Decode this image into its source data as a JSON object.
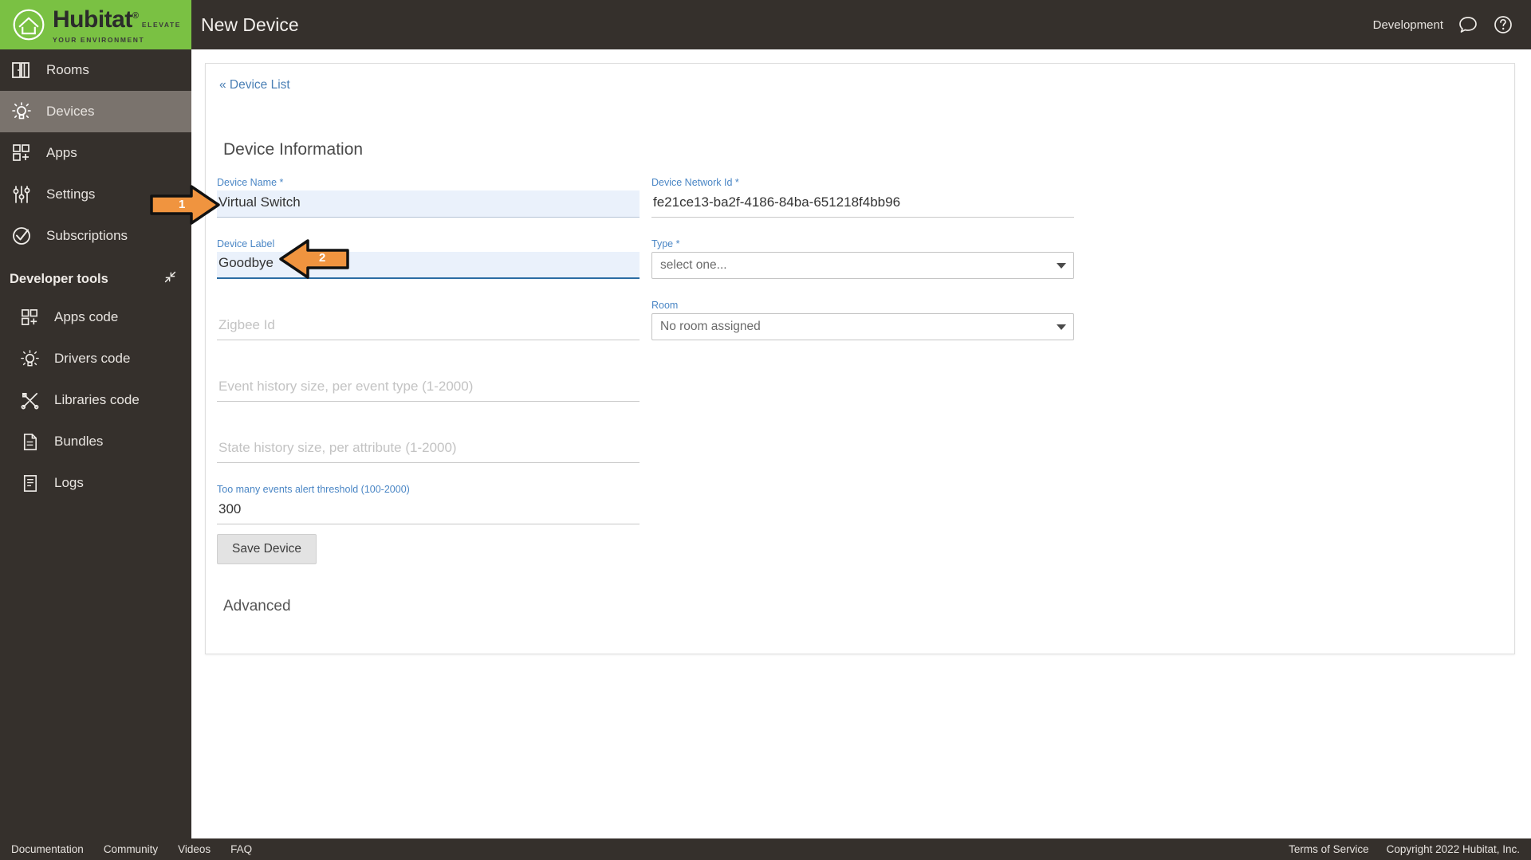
{
  "brand": {
    "name": "Hubitat",
    "registered": "®",
    "tagline": "ELEVATE YOUR ENVIRONMENT",
    "green": "#7ac143",
    "sidebar_bg": "#35302c"
  },
  "sidebar": {
    "items": [
      {
        "label": "Rooms",
        "icon": "door-icon",
        "active": false
      },
      {
        "label": "Devices",
        "icon": "bulb-icon",
        "active": true
      },
      {
        "label": "Apps",
        "icon": "grid-plus-icon",
        "active": false
      },
      {
        "label": "Settings",
        "icon": "sliders-icon",
        "active": false
      },
      {
        "label": "Subscriptions",
        "icon": "check-circle-icon",
        "active": false
      }
    ],
    "dev_tools": {
      "label": "Developer tools",
      "collapse_icon": "collapse-arrows-icon",
      "items": [
        {
          "label": "Apps code",
          "icon": "grid-plus-icon"
        },
        {
          "label": "Drivers code",
          "icon": "bulb-icon"
        },
        {
          "label": "Libraries code",
          "icon": "tools-icon"
        },
        {
          "label": "Bundles",
          "icon": "document-icon"
        },
        {
          "label": "Logs",
          "icon": "log-icon"
        }
      ]
    }
  },
  "topbar": {
    "title": "New Device",
    "environment": "Development",
    "chat_icon": "chat-bubble-icon",
    "help_icon": "help-circle-icon"
  },
  "main": {
    "back_link": "« Device List",
    "section_title": "Device Information",
    "advanced_title": "Advanced",
    "save_label": "Save Device",
    "fields_left": [
      {
        "label": "Device Name",
        "required": true,
        "value": "Virtual Switch",
        "placeholder": "",
        "state": "filled-hl"
      },
      {
        "label": "Device Label",
        "required": false,
        "value": "Goodbye",
        "placeholder": "",
        "state": "focused"
      },
      {
        "label": "",
        "required": false,
        "value": "",
        "placeholder": "Zigbee Id",
        "state": "empty"
      },
      {
        "label": "",
        "required": false,
        "value": "",
        "placeholder": "Event history size, per event type (1-2000)",
        "state": "empty"
      },
      {
        "label": "",
        "required": false,
        "value": "",
        "placeholder": "State history size, per attribute (1-2000)",
        "state": "empty"
      },
      {
        "label": "Too many events alert threshold (100-2000)",
        "required": false,
        "value": "300",
        "placeholder": "",
        "state": "empty"
      }
    ],
    "fields_right": [
      {
        "kind": "input",
        "label": "Device Network Id",
        "required": true,
        "value": "fe21ce13-ba2f-4186-84ba-651218f4bb96",
        "placeholder": "",
        "state": "empty"
      },
      {
        "kind": "select",
        "label": "Type",
        "required": true,
        "value": "select one...",
        "caret": "chevron-down-icon"
      },
      {
        "kind": "select",
        "label": "Room",
        "required": false,
        "value": "No room assigned",
        "caret": "chevron-down-icon"
      }
    ]
  },
  "callouts": [
    {
      "number": "1",
      "target": "device-name-input",
      "direction": "right"
    },
    {
      "number": "2",
      "target": "device-label-input",
      "direction": "left"
    }
  ],
  "footer": {
    "links": [
      "Documentation",
      "Community",
      "Videos",
      "FAQ"
    ],
    "terms": "Terms of Service",
    "copyright": "Copyright 2022 Hubitat, Inc."
  },
  "colors": {
    "accent_green": "#7ac143",
    "label_blue": "#4a86c5",
    "link_blue": "#4a7fb5",
    "highlight_field": "#eaf1fb",
    "focus_underline": "#2b6ca3",
    "callout_orange": "#f0943f"
  }
}
